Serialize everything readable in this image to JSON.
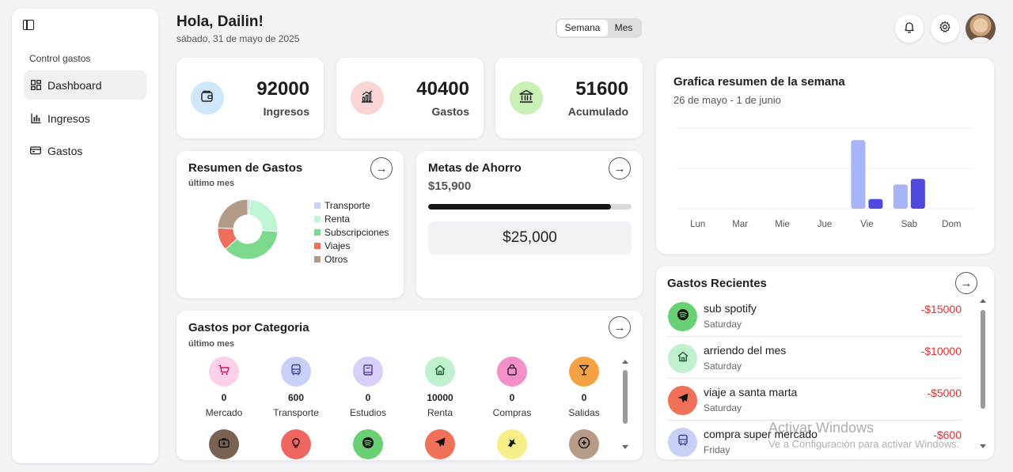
{
  "sidebar": {
    "section_label": "Control gastos",
    "items": [
      {
        "label": "Dashboard",
        "active": true
      },
      {
        "label": "Ingresos",
        "active": false
      },
      {
        "label": "Gastos",
        "active": false
      }
    ]
  },
  "header": {
    "greeting": "Hola, Dailin!",
    "date": "sábado, 31 de mayo de 2025",
    "period_toggle": {
      "week": "Semana",
      "month": "Mes",
      "selected": "Semana"
    }
  },
  "stats": [
    {
      "value": "92000",
      "label": "Ingresos",
      "icon": "wallet-icon",
      "color": "#cfe7fb"
    },
    {
      "value": "40400",
      "label": "Gastos",
      "icon": "bar-chart-icon",
      "color": "#fbd5d5"
    },
    {
      "value": "51600",
      "label": "Acumulado",
      "icon": "bank-icon",
      "color": "#c9f1b6"
    }
  ],
  "expense_summary": {
    "title": "Resumen de Gastos",
    "subtitle": "último mes",
    "slices": [
      {
        "label": "Transporte",
        "value": 600,
        "color": "#c7d3f7"
      },
      {
        "label": "Renta",
        "value": 10000,
        "color": "#bef5d3"
      },
      {
        "label": "Subscripciones",
        "value": 15000,
        "color": "#7ad98a"
      },
      {
        "label": "Viajes",
        "value": 5000,
        "color": "#ef6f5e"
      },
      {
        "label": "Otros",
        "value": 9800,
        "color": "#b29a86"
      }
    ]
  },
  "savings_goal": {
    "title": "Metas de Ahorro",
    "amount": "$15,900",
    "progress": 0.9,
    "goal": "$25,000"
  },
  "categories": {
    "title": "Gastos por Categoria",
    "subtitle": "último mes",
    "items": [
      {
        "value": "0",
        "label": "Mercado",
        "icon": "cart-icon",
        "color": "#fbd0e8"
      },
      {
        "value": "600",
        "label": "Transporte",
        "icon": "bus-icon",
        "color": "#c9d0f7"
      },
      {
        "value": "0",
        "label": "Estudios",
        "icon": "book-icon",
        "color": "#d9cffa"
      },
      {
        "value": "10000",
        "label": "Renta",
        "icon": "home-icon",
        "color": "#bff1cf"
      },
      {
        "value": "0",
        "label": "Compras",
        "icon": "bag-icon",
        "color": "#f58fc9"
      },
      {
        "value": "0",
        "label": "Salidas",
        "icon": "cocktail-icon",
        "color": "#f6a244"
      },
      {
        "value": "",
        "label": "",
        "icon": "medkit-icon",
        "color": "#7a6253"
      },
      {
        "value": "",
        "label": "",
        "icon": "bulb-icon",
        "color": "#ef6560"
      },
      {
        "value": "",
        "label": "",
        "icon": "spotify-icon",
        "color": "#69d174"
      },
      {
        "value": "",
        "label": "",
        "icon": "plane-icon",
        "color": "#f07058"
      },
      {
        "value": "",
        "label": "",
        "icon": "pet-icon",
        "color": "#f8ee88"
      },
      {
        "value": "",
        "label": "",
        "icon": "plus-circle-icon",
        "color": "#b89b86"
      }
    ]
  },
  "chart_data": {
    "type": "bar",
    "title": "Grafica resumen de la semana",
    "subtitle": "26 de mayo - 1 de junio",
    "categories": [
      "Lun",
      "Mar",
      "Mie",
      "Jue",
      "Vie",
      "Sab",
      "Dom"
    ],
    "series": [
      {
        "values": [
          0,
          0,
          0,
          0,
          85,
          30,
          0
        ],
        "color": "#a7b4f8"
      },
      {
        "values": [
          0,
          0,
          0,
          0,
          12,
          37,
          0
        ],
        "color": "#4f49de"
      }
    ],
    "ylim": [
      0,
      100
    ],
    "grid": true
  },
  "recent": {
    "title": "Gastos Recientes",
    "items": [
      {
        "name": "sub spotify",
        "day": "Saturday",
        "amount": "-$15000",
        "icon": "spotify-icon",
        "color": "#69d174"
      },
      {
        "name": "arriendo del mes",
        "day": "Saturday",
        "amount": "-$10000",
        "icon": "home-icon",
        "color": "#bff1cf"
      },
      {
        "name": "viaje a santa marta",
        "day": "Saturday",
        "amount": "-$5000",
        "icon": "plane-icon",
        "color": "#f07058"
      },
      {
        "name": "compra super mercado",
        "day": "Friday",
        "amount": "-$600",
        "icon": "bus-icon",
        "color": "#c9d0f7"
      }
    ]
  },
  "watermark": {
    "line1": "Activar Windows",
    "line2": "Ve a Configuración para activar Windows."
  }
}
